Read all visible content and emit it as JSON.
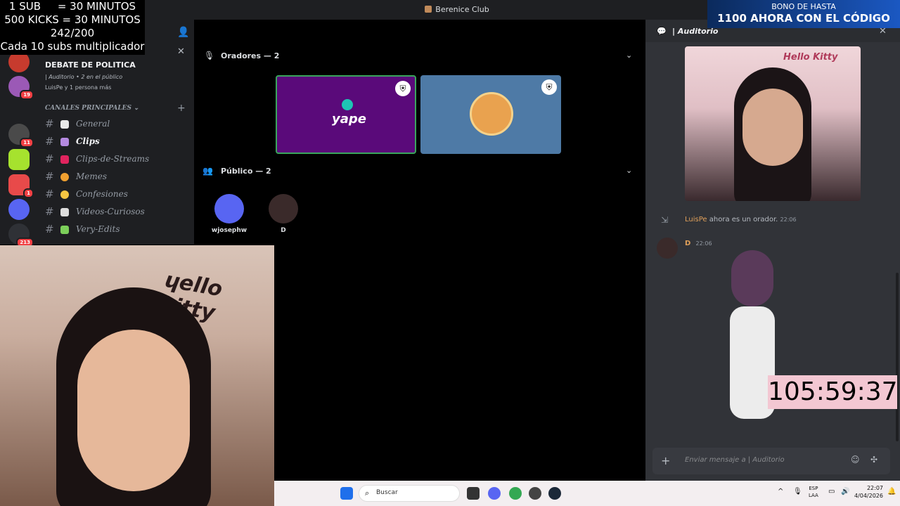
{
  "overlay": {
    "line1": "1 SUB     = 30 MINUTOS",
    "line2": "500 KICKS = 30 MINUTOS",
    "line3": "242/200",
    "line4": "Cada 10 subs multiplicador"
  },
  "window": {
    "title": "Berenice Club"
  },
  "event": {
    "title": "DEBATE DE POLITICA",
    "meta": "| Auditorio • 2 en el público",
    "attendees": "LuisPe y 1 persona más"
  },
  "servers": [
    {
      "badge": "19"
    },
    {
      "badge": "11"
    },
    {
      "badge": ""
    },
    {
      "badge": "1"
    },
    {
      "badge": ""
    },
    {
      "badge": "213"
    }
  ],
  "channels": {
    "category": "CANALES PRINCIPALES",
    "items": [
      {
        "name": "General"
      },
      {
        "name": "Clips"
      },
      {
        "name": "Clips-de-Streams"
      },
      {
        "name": "Memes"
      },
      {
        "name": "Confesiones"
      },
      {
        "name": "Videos-Curiosos"
      },
      {
        "name": "Very-Edits"
      }
    ]
  },
  "stage": {
    "speakers_title": "Oradores — 2",
    "audience_title": "Público — 2",
    "audience": [
      {
        "name": "wjosephw"
      },
      {
        "name": "D"
      }
    ],
    "yape_text": "yape"
  },
  "chat": {
    "channel_name": "| Auditorio",
    "system_user": "LuisPe",
    "system_text": "ahora es un orador.",
    "system_time": "22:06",
    "msg_user": "D",
    "msg_time": "22:06",
    "input_placeholder": "Enviar mensaje a  | Auditorio"
  },
  "promo": {
    "top": "BONO DE HASTA",
    "main": "1100 AHORA CON EL CÓDIGO"
  },
  "timer": "105:59:37",
  "taskbar": {
    "search": "Buscar",
    "lang1": "ESP",
    "lang2": "LAA",
    "time": "22:07",
    "date": "4/04/2026"
  },
  "colors": {
    "yape_purple": "#5a0a7a",
    "speaker_blue": "#4e7aa6",
    "discord_blurple": "#5865f2",
    "mention_orange": "#e0a05a",
    "timer_bg": "#f3c7d2"
  }
}
